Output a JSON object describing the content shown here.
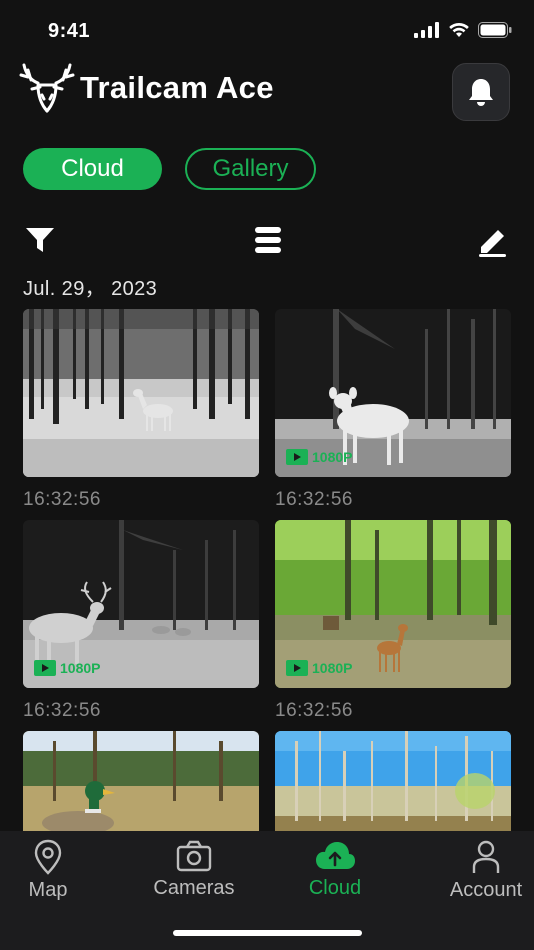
{
  "status": {
    "time": "9:41"
  },
  "brand": {
    "name": "Trailcam Ace",
    "logo_icon": "deer-head-icon"
  },
  "segments": {
    "cloud": "Cloud",
    "gallery": "Gallery",
    "active": "Cloud"
  },
  "toolbar": {
    "filter_icon": "filter-icon",
    "list_icon": "list-icon",
    "edit_icon": "edit-icon"
  },
  "date_header": "Jul. 29， 2023",
  "items": [
    {
      "time": "16:32:56",
      "video": false,
      "scene": "night-snow-lake-deer"
    },
    {
      "time": "16:32:56",
      "video": true,
      "resolution": "1080P",
      "scene": "night-snow-doe"
    },
    {
      "time": "16:32:56",
      "video": true,
      "resolution": "1080P",
      "scene": "night-snow-buck"
    },
    {
      "time": "16:32:56",
      "video": true,
      "resolution": "1080P",
      "scene": "green-forest-fawn"
    },
    {
      "time": "",
      "video": false,
      "scene": "field-duck"
    },
    {
      "time": "",
      "video": false,
      "scene": "spring-trees-blue-sky"
    }
  ],
  "tabbar": {
    "map": "Map",
    "cameras": "Cameras",
    "cloud": "Cloud",
    "account": "Account",
    "active": "Cloud"
  },
  "colors": {
    "accent": "#1bb155",
    "background": "#121212",
    "tabbar": "#1c1c1e"
  }
}
